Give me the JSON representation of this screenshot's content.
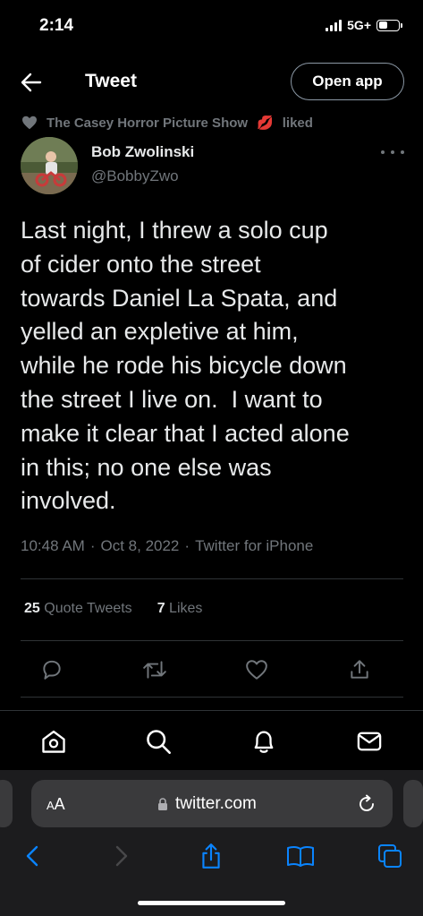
{
  "status_bar": {
    "time": "2:14",
    "network": "5G+"
  },
  "header": {
    "title": "Tweet",
    "open_app_label": "Open app",
    "back_icon": "arrow-left-icon"
  },
  "social_context": {
    "liker": "The Casey Horror Picture Show",
    "liker_emoji": "💋",
    "action": "liked",
    "icon": "heart-icon"
  },
  "tweet": {
    "display_name": "Bob Zwolinski",
    "handle": "@BobbyZwo",
    "text": "Last night, I threw a solo cup\nof cider onto the street\ntowards Daniel La Spata, and\nyelled an expletive at him,\nwhile he rode his bicycle down\nthe street I live on.  I want to\nmake it clear that I acted alone\nin this; no one else was\ninvolved.",
    "time": "10:48 AM",
    "date": "Oct 8, 2022",
    "source": "Twitter for iPhone",
    "separator": "·"
  },
  "stats": {
    "quote_tweets_count": "25",
    "quote_tweets_label": "Quote Tweets",
    "likes_count": "7",
    "likes_label": "Likes"
  },
  "actions": [
    "reply-icon",
    "retweet-icon",
    "like-icon",
    "share-icon"
  ],
  "tabbar": [
    "home-icon",
    "search-icon",
    "notifications-icon",
    "messages-icon"
  ],
  "safari": {
    "aa_label_small": "A",
    "aa_label_large": "A",
    "url": "twitter.com",
    "nav": [
      "back-icon",
      "forward-icon",
      "share-icon",
      "bookmarks-icon",
      "tabs-icon"
    ]
  },
  "colors": {
    "background": "#000000",
    "text_primary": "#e7e9ea",
    "text_secondary": "#71767b",
    "divider": "#2f3336",
    "safari_blue": "#0a84ff"
  }
}
